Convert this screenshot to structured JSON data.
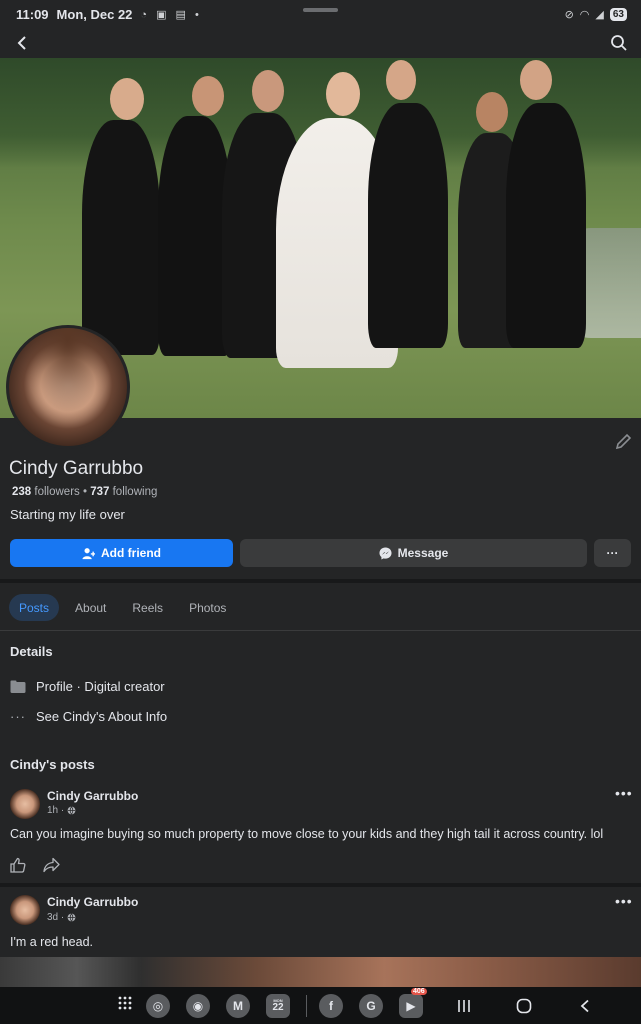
{
  "status_bar": {
    "time": "11:09",
    "date": "Mon, Dec 22",
    "battery": "63"
  },
  "profile": {
    "name": "Cindy Garrubbo",
    "followers_count": "238",
    "followers_label": "followers",
    "following_count": "737",
    "following_label": "following",
    "bio": "Starting my life over"
  },
  "actions": {
    "add_friend": "Add friend",
    "message": "Message",
    "more": "···"
  },
  "tabs": [
    {
      "label": "Posts",
      "active": true
    },
    {
      "label": "About"
    },
    {
      "label": "Reels"
    },
    {
      "label": "Photos"
    }
  ],
  "details": {
    "title": "Details",
    "profile_type_label": "Profile",
    "profile_type_value": "· Digital creator",
    "see_about": "See Cindy's About Info"
  },
  "posts_section": {
    "title": "Cindy's posts",
    "posts": [
      {
        "author": "Cindy Garrubbo",
        "time": "1h ·",
        "text": "Can you imagine buying so much property to move close to your kids and they high tail it across country. lol"
      },
      {
        "author": "Cindy Garrubbo",
        "time": "3d ·",
        "text": "I'm a red head."
      }
    ]
  },
  "nav_apps": {
    "calendar_day": "22",
    "calendar_month": "MON",
    "youtube_badge": "406"
  },
  "colors": {
    "background": "#242526",
    "accent": "#1877f2",
    "active_tab_bg": "#263951",
    "active_tab_text": "#4599ff"
  }
}
